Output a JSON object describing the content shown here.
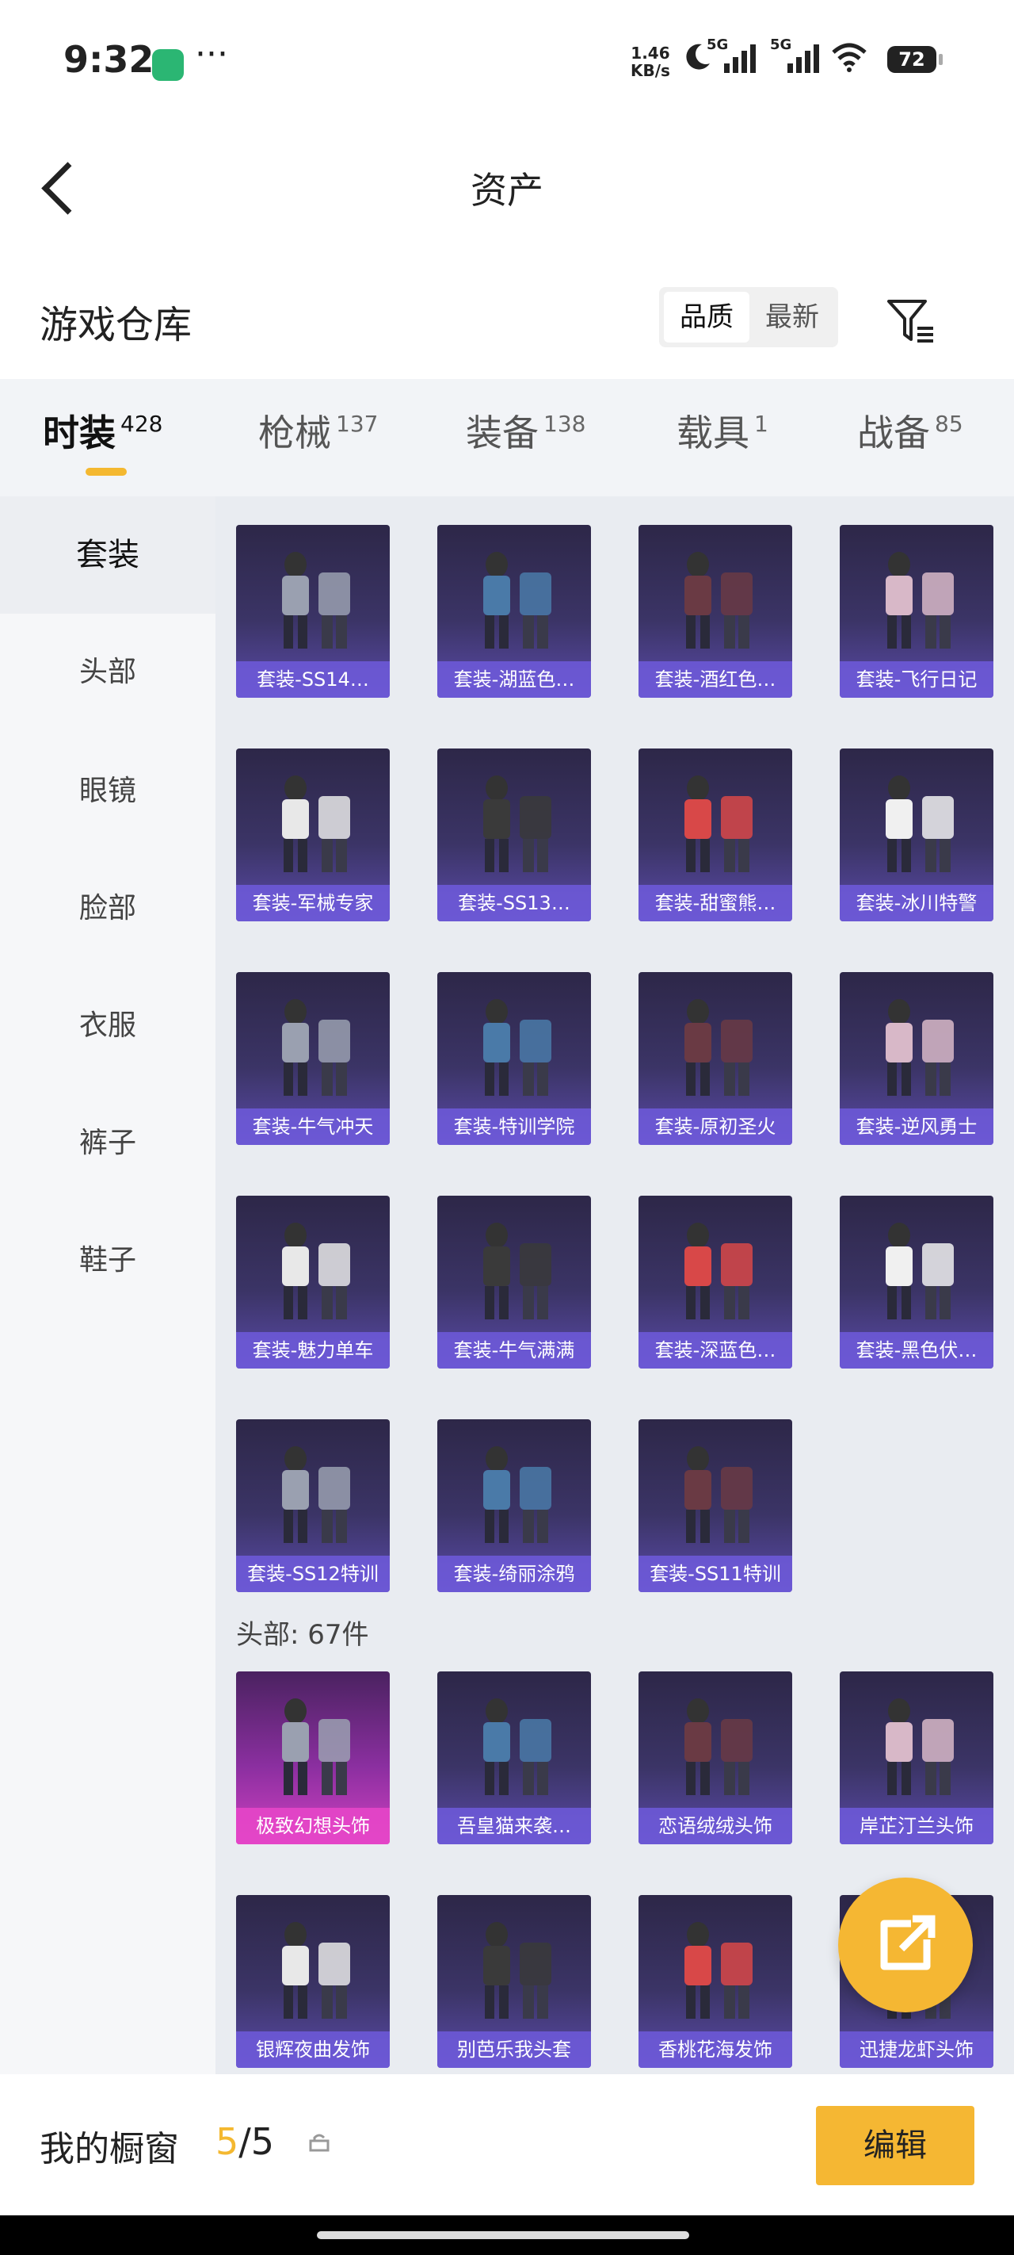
{
  "status": {
    "time": "9:32",
    "net_speed_value": "1.46",
    "net_speed_unit": "KB/s",
    "sim1": "5G",
    "sim2": "5G",
    "battery": "72"
  },
  "header": {
    "title": "资产"
  },
  "warehouse": {
    "title": "游戏仓库",
    "sort_options": [
      "品质",
      "最新"
    ],
    "selected_sort": "品质"
  },
  "tabs": [
    {
      "label": "时装",
      "count": "428"
    },
    {
      "label": "枪械",
      "count": "137"
    },
    {
      "label": "装备",
      "count": "138"
    },
    {
      "label": "载具",
      "count": "1"
    },
    {
      "label": "战备",
      "count": "85"
    }
  ],
  "sidebar": [
    "套装",
    "头部",
    "眼镜",
    "脸部",
    "衣服",
    "裤子",
    "鞋子"
  ],
  "suits": [
    "套装-SS14…",
    "套装-湖蓝色…",
    "套装-酒红色…",
    "套装-飞行日记",
    "套装-军械专家",
    "套装-SS13…",
    "套装-甜蜜熊…",
    "套装-冰川特警",
    "套装-牛气冲天",
    "套装-特训学院",
    "套装-原初圣火",
    "套装-逆风勇士",
    "套装-魅力单车",
    "套装-牛气满满",
    "套装-深蓝色…",
    "套装-黑色伏…",
    "套装-SS12特训",
    "套装-绮丽涂鸦",
    "套装-SS11特训"
  ],
  "head_section": "头部: 67件",
  "heads": [
    "极致幻想头饰",
    "吾皇猫来袭…",
    "恋语绒绒头饰",
    "岸芷汀兰头饰",
    "银辉夜曲发饰",
    "别芭乐我头套",
    "香桃花海发饰",
    "迅捷龙虾头饰"
  ],
  "bottom": {
    "label": "我的橱窗",
    "current": "5",
    "separator": "/",
    "total": "5",
    "edit": "编辑"
  },
  "colors": {
    "accent": "#f5b733",
    "card_top": "#2d2748",
    "card_bottom": "#5a4aa8"
  }
}
